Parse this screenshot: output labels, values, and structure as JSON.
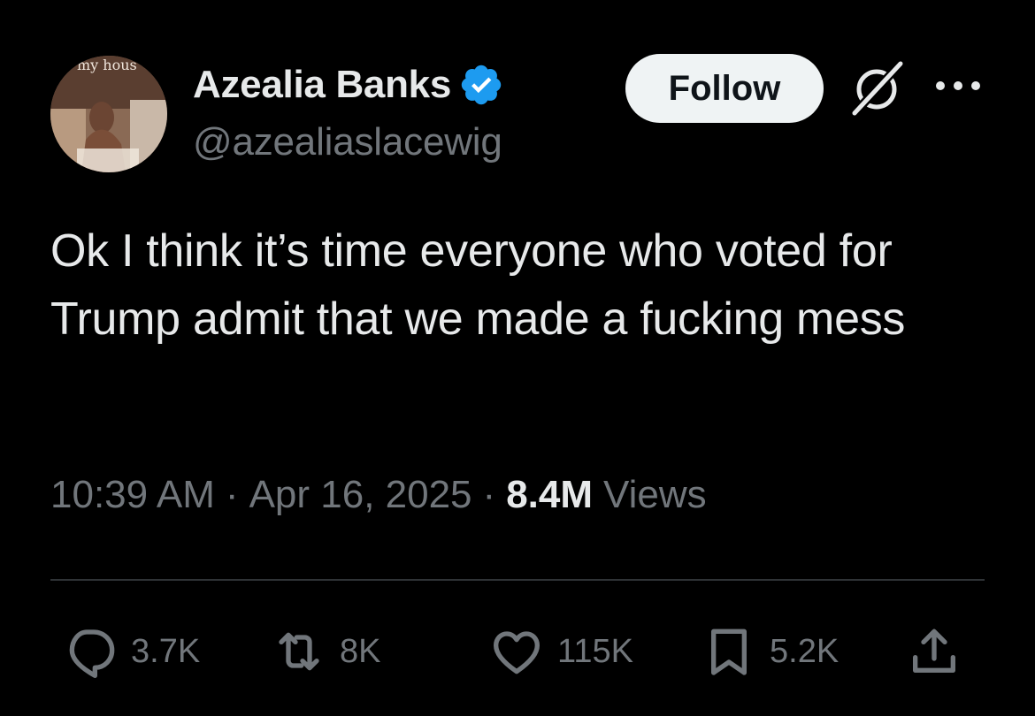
{
  "author": {
    "display_name": "Azealia Banks",
    "handle": "@azealiaslacewig",
    "verified": true,
    "avatar_caption": "my hous"
  },
  "header": {
    "follow_label": "Follow",
    "icons": [
      "verified-badge-icon",
      "grok-icon",
      "more-icon"
    ]
  },
  "tweet": {
    "text": "Ok I think it’s time everyone who voted for Trump admit that we made a fucking mess",
    "time": "10:39 AM",
    "separator": "·",
    "date": "Apr 16, 2025",
    "views_count": "8.4M",
    "views_label": "Views"
  },
  "actions": {
    "reply_count": "3.7K",
    "repost_count": "8K",
    "like_count": "115K",
    "bookmark_count": "5.2K",
    "icons": [
      "reply-icon",
      "repost-icon",
      "like-icon",
      "bookmark-icon",
      "share-icon"
    ]
  },
  "colors": {
    "background": "#000000",
    "text_primary": "#e7e9ea",
    "text_secondary": "#71767b",
    "divider": "#2f3336",
    "verified_blue": "#1d9bf0",
    "follow_button_bg": "#eff3f4",
    "follow_button_text": "#0f1419"
  }
}
